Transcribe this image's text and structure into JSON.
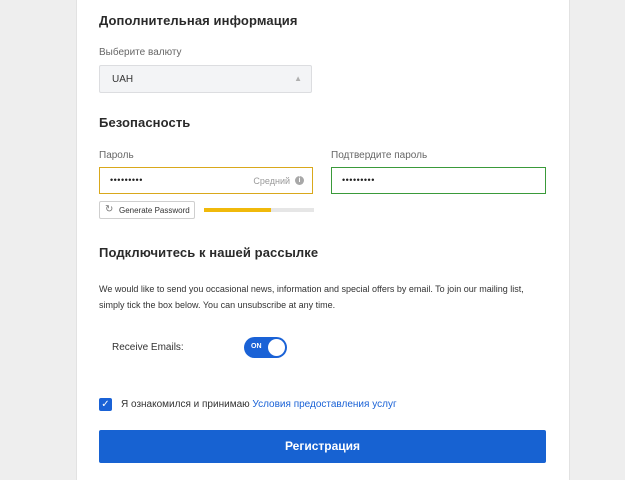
{
  "additional": {
    "heading": "Дополнительная информация",
    "currency_label": "Выберите валюту",
    "currency_value": "UAH",
    "currency_caret": "▲"
  },
  "security": {
    "heading": "Безопасность",
    "password_label": "Пароль",
    "password_value": "•••••••••",
    "strength_text": "Средний",
    "info_glyph": "i",
    "confirm_label": "Подтвердите пароль",
    "confirm_value": "•••••••••",
    "generate_icon": "↻",
    "generate_label": "Generate Password",
    "strength_fraction": 0.61,
    "strength_color": "#f0b90b"
  },
  "newsletter": {
    "heading": "Подключитесь к нашей рассылке",
    "description": "We would like to send you occasional news, information and special offers by email. To join our mailing list, simply tick the box below. You can unsubscribe at any time.",
    "receive_label": "Receive Emails:",
    "toggle_state": "ON"
  },
  "terms": {
    "checked_glyph": "✓",
    "text": "Я ознакомился и принимаю ",
    "link": "Условия предоставления услуг"
  },
  "submit": {
    "label": "Регистрация"
  },
  "colors": {
    "accent": "#1762d2",
    "warning_border": "#d9a81b",
    "success_border": "#3a9a3a"
  }
}
